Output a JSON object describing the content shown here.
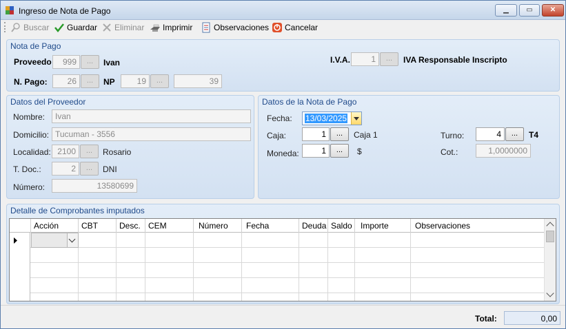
{
  "window": {
    "title": "Ingreso de Nota de Pago"
  },
  "toolbar": {
    "buscar": "Buscar",
    "guardar": "Guardar",
    "eliminar": "Eliminar",
    "imprimir": "Imprimir",
    "observaciones": "Observaciones",
    "cancelar": "Cancelar"
  },
  "nota_pago": {
    "title": "Nota de Pago",
    "proveedor_label": "Proveedo",
    "proveedor_code": "999",
    "proveedor_name": "Ivan",
    "iva_label": "I.V.A.",
    "iva_code": "1",
    "iva_desc": "IVA Responsable Inscripto",
    "npago_label": "N. Pago:",
    "npago_value": "26",
    "np_label": "NP",
    "np_value": "19",
    "np_number": "39"
  },
  "proveedor": {
    "title": "Datos del Proveedor",
    "nombre_label": "Nombre:",
    "nombre": "Ivan",
    "domicilio_label": "Domicilio:",
    "domicilio": "Tucuman  - 3556",
    "localidad_label": "Localidad:",
    "localidad_code": "2100",
    "localidad_name": "Rosario",
    "tdoc_label": "T. Doc.:",
    "tdoc_code": "2",
    "tdoc_name": "DNI",
    "numero_label": "Número:",
    "numero": "13580699"
  },
  "datos_nota": {
    "title": "Datos de la Nota de Pago",
    "fecha_label": "Fecha:",
    "fecha": "13/03/2025",
    "caja_label": "Caja:",
    "caja_code": "1",
    "caja_name": "Caja 1",
    "turno_label": "Turno:",
    "turno_code": "4",
    "turno_name": "T4",
    "moneda_label": "Moneda:",
    "moneda_code": "1",
    "moneda_symbol": "$",
    "cot_label": "Cot.:",
    "cot_value": "1,0000000",
    "dots": "..."
  },
  "detalle": {
    "title": "Detalle de Comprobantes imputados",
    "columns": [
      "Acción",
      "CBT",
      "Desc.",
      "CEM",
      "Número",
      "Fecha",
      "Deuda",
      "Saldo",
      "Importe",
      "Observaciones"
    ]
  },
  "footer": {
    "total_label": "Total:",
    "total_value": "0,00"
  },
  "colors": {
    "panel_title": "#1f4a8a",
    "selection": "#3399ff",
    "panel_bg": "#dbe6f4"
  }
}
